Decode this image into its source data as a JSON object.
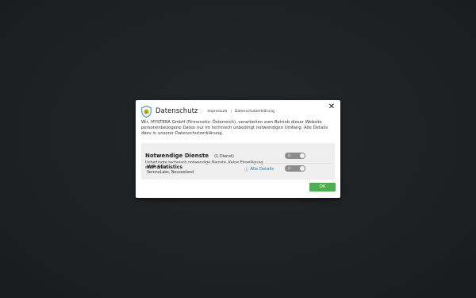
{
  "dialog": {
    "title": "Datenschutz",
    "close_glyph": "✕",
    "links": [
      "Impressum",
      "Datenschutzerklärung"
    ],
    "link_separator": "|",
    "description": "Wir, MYSTERA GmbH (Firmensitz: Österreich), verarbeiten zum Betrieb dieser Website personenbezogene Daten nur im technisch unbedingt notwendigen Umfang. Alle Details dazu in unserer Datenschutzerklärung.",
    "group": {
      "title": "Notwendige Dienste",
      "count": "(1 Dienst)",
      "description": "Unbedingte technisch notwendige Dienste. Keine Einwilligung erforderlich.",
      "toggle_label": "ja",
      "service": {
        "name": "WP Statistics",
        "provider": "VeronaLabs, Neuseeland",
        "details_label": "Alle Details",
        "details_icon": "info-icon",
        "toggle_label": "ja"
      }
    },
    "ok_label": "OK"
  },
  "colors": {
    "ok_button": "#4caf50",
    "link": "#1f6fb5",
    "toggle": "#8c8c8c",
    "shield": "#1e88c8",
    "shield_badge": "#f5b400"
  }
}
